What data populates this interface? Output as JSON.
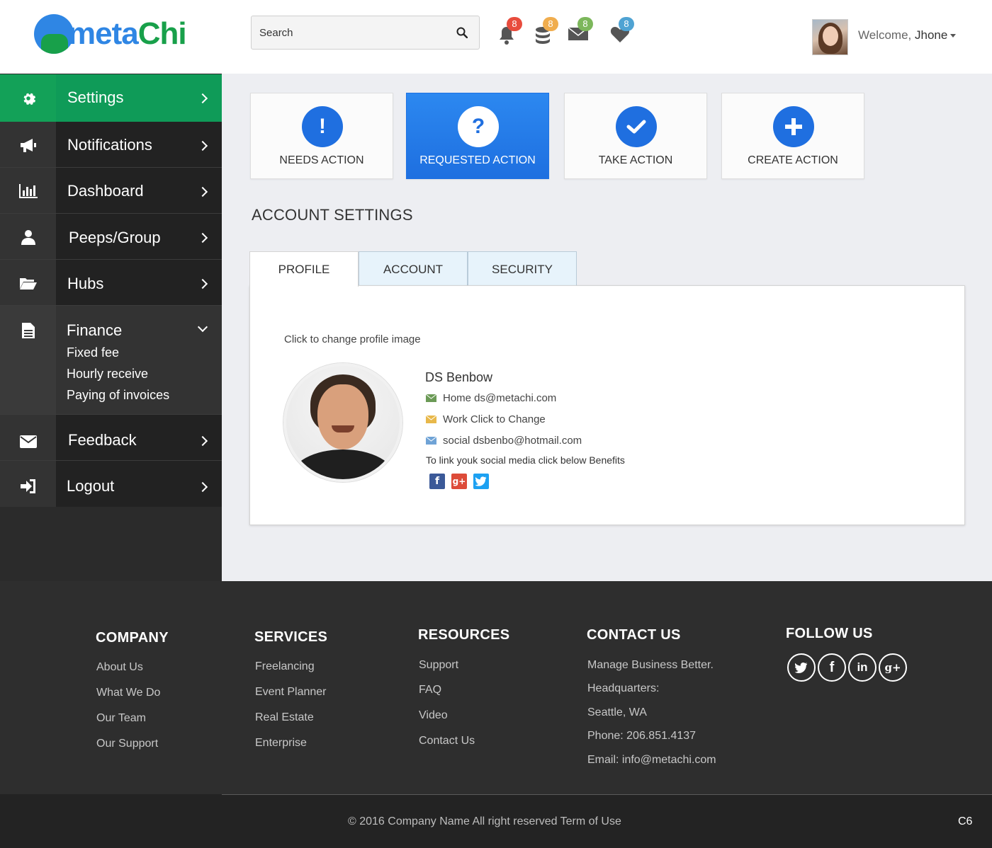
{
  "brand": {
    "name_part1": "meta",
    "name_part2": "Chi",
    "logo_initial": "m"
  },
  "header": {
    "search_placeholder": "Search",
    "badges": [
      {
        "name": "bell",
        "count": "8",
        "color": "#e84c3d"
      },
      {
        "name": "database",
        "count": "8",
        "color": "#f0ad4e"
      },
      {
        "name": "mail",
        "count": "8",
        "color": "#7cb75b"
      },
      {
        "name": "heart",
        "count": "8",
        "color": "#4fa3d3"
      }
    ],
    "welcome_text": "Welcome,",
    "user_name": "Jhone"
  },
  "sidebar": {
    "items": [
      {
        "label": "Settings",
        "icon": "gear-icon"
      },
      {
        "label": "Notifications",
        "icon": "megaphone-icon"
      },
      {
        "label": "Dashboard",
        "icon": "bar-chart-icon"
      },
      {
        "label": "Peeps/Group",
        "icon": "user-icon"
      },
      {
        "label": "Hubs",
        "icon": "folder-icon"
      },
      {
        "label": "Finance",
        "icon": "document-icon",
        "sub": [
          "Fixed fee",
          "Hourly receive",
          "Paying of invoices"
        ]
      },
      {
        "label": "Feedback",
        "icon": "envelope-icon"
      },
      {
        "label": "Logout",
        "icon": "logout-icon"
      }
    ]
  },
  "actions": [
    {
      "label": "NEEDS ACTION",
      "glyph": "!"
    },
    {
      "label": "REQUESTED ACTION",
      "glyph": "?"
    },
    {
      "label": "TAKE ACTION",
      "glyph": "check"
    },
    {
      "label": "CREATE ACTION",
      "glyph": "plus"
    }
  ],
  "account": {
    "title": "ACCOUNT SETTINGS",
    "tabs": [
      "PROFILE",
      "ACCOUNT",
      "SECURITY"
    ],
    "change_image_label": "Click to change profile image",
    "name": "DS Benbow",
    "home_email": "Home ds@metachi.com",
    "work_email": "Work Click to Change",
    "social_email": "social dsbenbo@hotmail.com",
    "social_note": "To link youk social media click below Benefits",
    "colors": {
      "home": "#6b9a56",
      "work": "#e8b84a",
      "social": "#6fa3d6"
    }
  },
  "footer": {
    "company": {
      "title": "COMPANY",
      "links": [
        "About Us",
        "What We Do",
        "Our Team",
        "Our Support"
      ]
    },
    "services": {
      "title": "SERVICES",
      "links": [
        "Freelancing",
        "Event Planner",
        "Real Estate",
        "Enterprise"
      ]
    },
    "resources": {
      "title": "RESOURCES",
      "links": [
        "Support",
        "FAQ",
        "Video",
        "Contact Us"
      ]
    },
    "contact": {
      "title": "CONTACT US",
      "lines": [
        "Manage Business Better.",
        "Headquarters:",
        "Seattle, WA",
        "Phone: 206.851.4137",
        "Email: info@metachi.com"
      ]
    },
    "follow": {
      "title": "FOLLOW US",
      "icons": [
        "twitter-icon",
        "facebook-icon",
        "linkedin-icon",
        "google-plus-icon"
      ]
    },
    "copyright": "© 2016 Company Name  All right reserved  Term of Use",
    "corner": "C6"
  }
}
